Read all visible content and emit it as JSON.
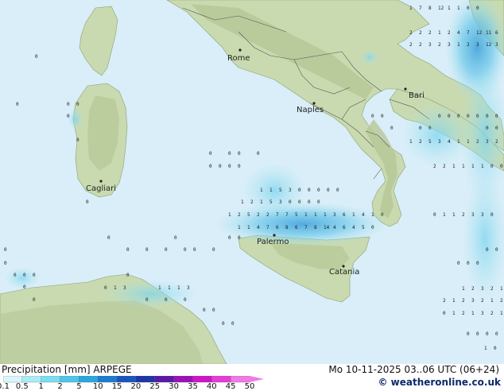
{
  "map": {
    "cities": [
      {
        "name": "Rome",
        "label": "Rome"
      },
      {
        "name": "Naples",
        "label": "Naples"
      },
      {
        "name": "Bari",
        "label": "Bari"
      },
      {
        "name": "Cagliari",
        "label": "Cagliari"
      },
      {
        "name": "Palermo",
        "label": "Palermo"
      },
      {
        "name": "Catania",
        "label": "Catania"
      }
    ],
    "colors": {
      "sea": "#d9eef8",
      "land": "#c9dab0",
      "mountain": "#aebf8e",
      "border": "#555555",
      "precip_light": "#a8e4f0",
      "precip_mid": "#6cc8ea",
      "precip_heavy": "#3a9fd8"
    }
  },
  "legend": {
    "title": "Precipitation [mm]  ARPEGE",
    "date": "Mo 10-11-2025 03..06 UTC (06+24)",
    "credit": "© weatheronline.co.uk",
    "scale": [
      {
        "label": "0.1",
        "color": "#ffffff"
      },
      {
        "label": "0.5",
        "color": "#d8f6fb"
      },
      {
        "label": "1",
        "color": "#a9ecf5"
      },
      {
        "label": "2",
        "color": "#7cdcf0"
      },
      {
        "label": "5",
        "color": "#4cc6ea"
      },
      {
        "label": "10",
        "color": "#2aa6e0"
      },
      {
        "label": "15",
        "color": "#1e7bd0"
      },
      {
        "label": "20",
        "color": "#1a55bf"
      },
      {
        "label": "25",
        "color": "#1d36a8"
      },
      {
        "label": "30",
        "color": "#5a1aa8"
      },
      {
        "label": "35",
        "color": "#9a12b8"
      },
      {
        "label": "40",
        "color": "#d014c8"
      },
      {
        "label": "45",
        "color": "#e63cd8"
      },
      {
        "label": "50",
        "color": "#f07ae6"
      }
    ]
  },
  "grid_values": [
    {
      "v": "1"
    },
    {
      "v": "7"
    },
    {
      "v": "8"
    },
    {
      "v": "12"
    },
    {
      "v": "1"
    },
    {
      "v": "1"
    },
    {
      "v": "0"
    },
    {
      "v": "0"
    },
    {
      "v": "2"
    },
    {
      "v": "2"
    },
    {
      "v": "2"
    },
    {
      "v": "1"
    },
    {
      "v": "2"
    },
    {
      "v": "4"
    },
    {
      "v": "7"
    },
    {
      "v": "12"
    },
    {
      "v": "11"
    },
    {
      "v": "6"
    },
    {
      "v": "2"
    },
    {
      "v": "2"
    },
    {
      "v": "3"
    },
    {
      "v": "2"
    },
    {
      "v": "3"
    },
    {
      "v": "1"
    },
    {
      "v": "2"
    },
    {
      "v": "3"
    },
    {
      "v": "12"
    },
    {
      "v": "3"
    },
    {
      "v": "1"
    },
    {
      "v": "1"
    },
    {
      "v": "5"
    },
    {
      "v": "3"
    },
    {
      "v": "0"
    },
    {
      "v": "0"
    },
    {
      "v": "0"
    },
    {
      "v": "0"
    },
    {
      "v": "0"
    },
    {
      "v": "1"
    },
    {
      "v": "2"
    },
    {
      "v": "1"
    },
    {
      "v": "5"
    },
    {
      "v": "3"
    },
    {
      "v": "0"
    },
    {
      "v": "0"
    },
    {
      "v": "0"
    },
    {
      "v": "0"
    },
    {
      "v": "1"
    },
    {
      "v": "1"
    },
    {
      "v": "4"
    },
    {
      "v": "7"
    },
    {
      "v": "6"
    },
    {
      "v": "8"
    },
    {
      "v": "6"
    },
    {
      "v": "7"
    },
    {
      "v": "8"
    },
    {
      "v": "14"
    },
    {
      "v": "4"
    },
    {
      "v": "6"
    },
    {
      "v": "4"
    },
    {
      "v": "5"
    },
    {
      "v": "0"
    },
    {
      "v": "1"
    },
    {
      "v": "2"
    },
    {
      "v": "5"
    },
    {
      "v": "2"
    },
    {
      "v": "2"
    },
    {
      "v": "7"
    },
    {
      "v": "7"
    },
    {
      "v": "5"
    },
    {
      "v": "1"
    },
    {
      "v": "1"
    },
    {
      "v": "1"
    },
    {
      "v": "3"
    },
    {
      "v": "6"
    },
    {
      "v": "1"
    },
    {
      "v": "4"
    },
    {
      "v": "1"
    },
    {
      "v": "0"
    },
    {
      "v": "0"
    },
    {
      "v": "1"
    },
    {
      "v": "1"
    },
    {
      "v": "2"
    },
    {
      "v": "3"
    },
    {
      "v": "3"
    },
    {
      "v": "0"
    },
    {
      "v": "1"
    },
    {
      "v": "2"
    },
    {
      "v": "5"
    },
    {
      "v": "3"
    },
    {
      "v": "4"
    },
    {
      "v": "1"
    },
    {
      "v": "1"
    },
    {
      "v": "2"
    },
    {
      "v": "3"
    },
    {
      "v": "2"
    },
    {
      "v": "2"
    },
    {
      "v": "2"
    },
    {
      "v": "1"
    },
    {
      "v": "1"
    },
    {
      "v": "1"
    },
    {
      "v": "1"
    },
    {
      "v": "0"
    },
    {
      "v": "0"
    },
    {
      "v": "1"
    },
    {
      "v": "2"
    },
    {
      "v": "3"
    },
    {
      "v": "2"
    },
    {
      "v": "1"
    },
    {
      "v": "2"
    },
    {
      "v": "2"
    },
    {
      "v": "1"
    },
    {
      "v": "2"
    },
    {
      "v": "1"
    },
    {
      "v": "3"
    },
    {
      "v": "2"
    },
    {
      "v": "1"
    },
    {
      "v": "0"
    },
    {
      "v": "1"
    },
    {
      "v": "2"
    },
    {
      "v": "3"
    },
    {
      "v": "2"
    },
    {
      "v": "1"
    },
    {
      "v": "0"
    },
    {
      "v": "1"
    },
    {
      "v": "3"
    },
    {
      "v": "1"
    },
    {
      "v": "1"
    },
    {
      "v": "1"
    },
    {
      "v": "3"
    },
    {
      "v": "1"
    },
    {
      "v": "0"
    }
  ]
}
